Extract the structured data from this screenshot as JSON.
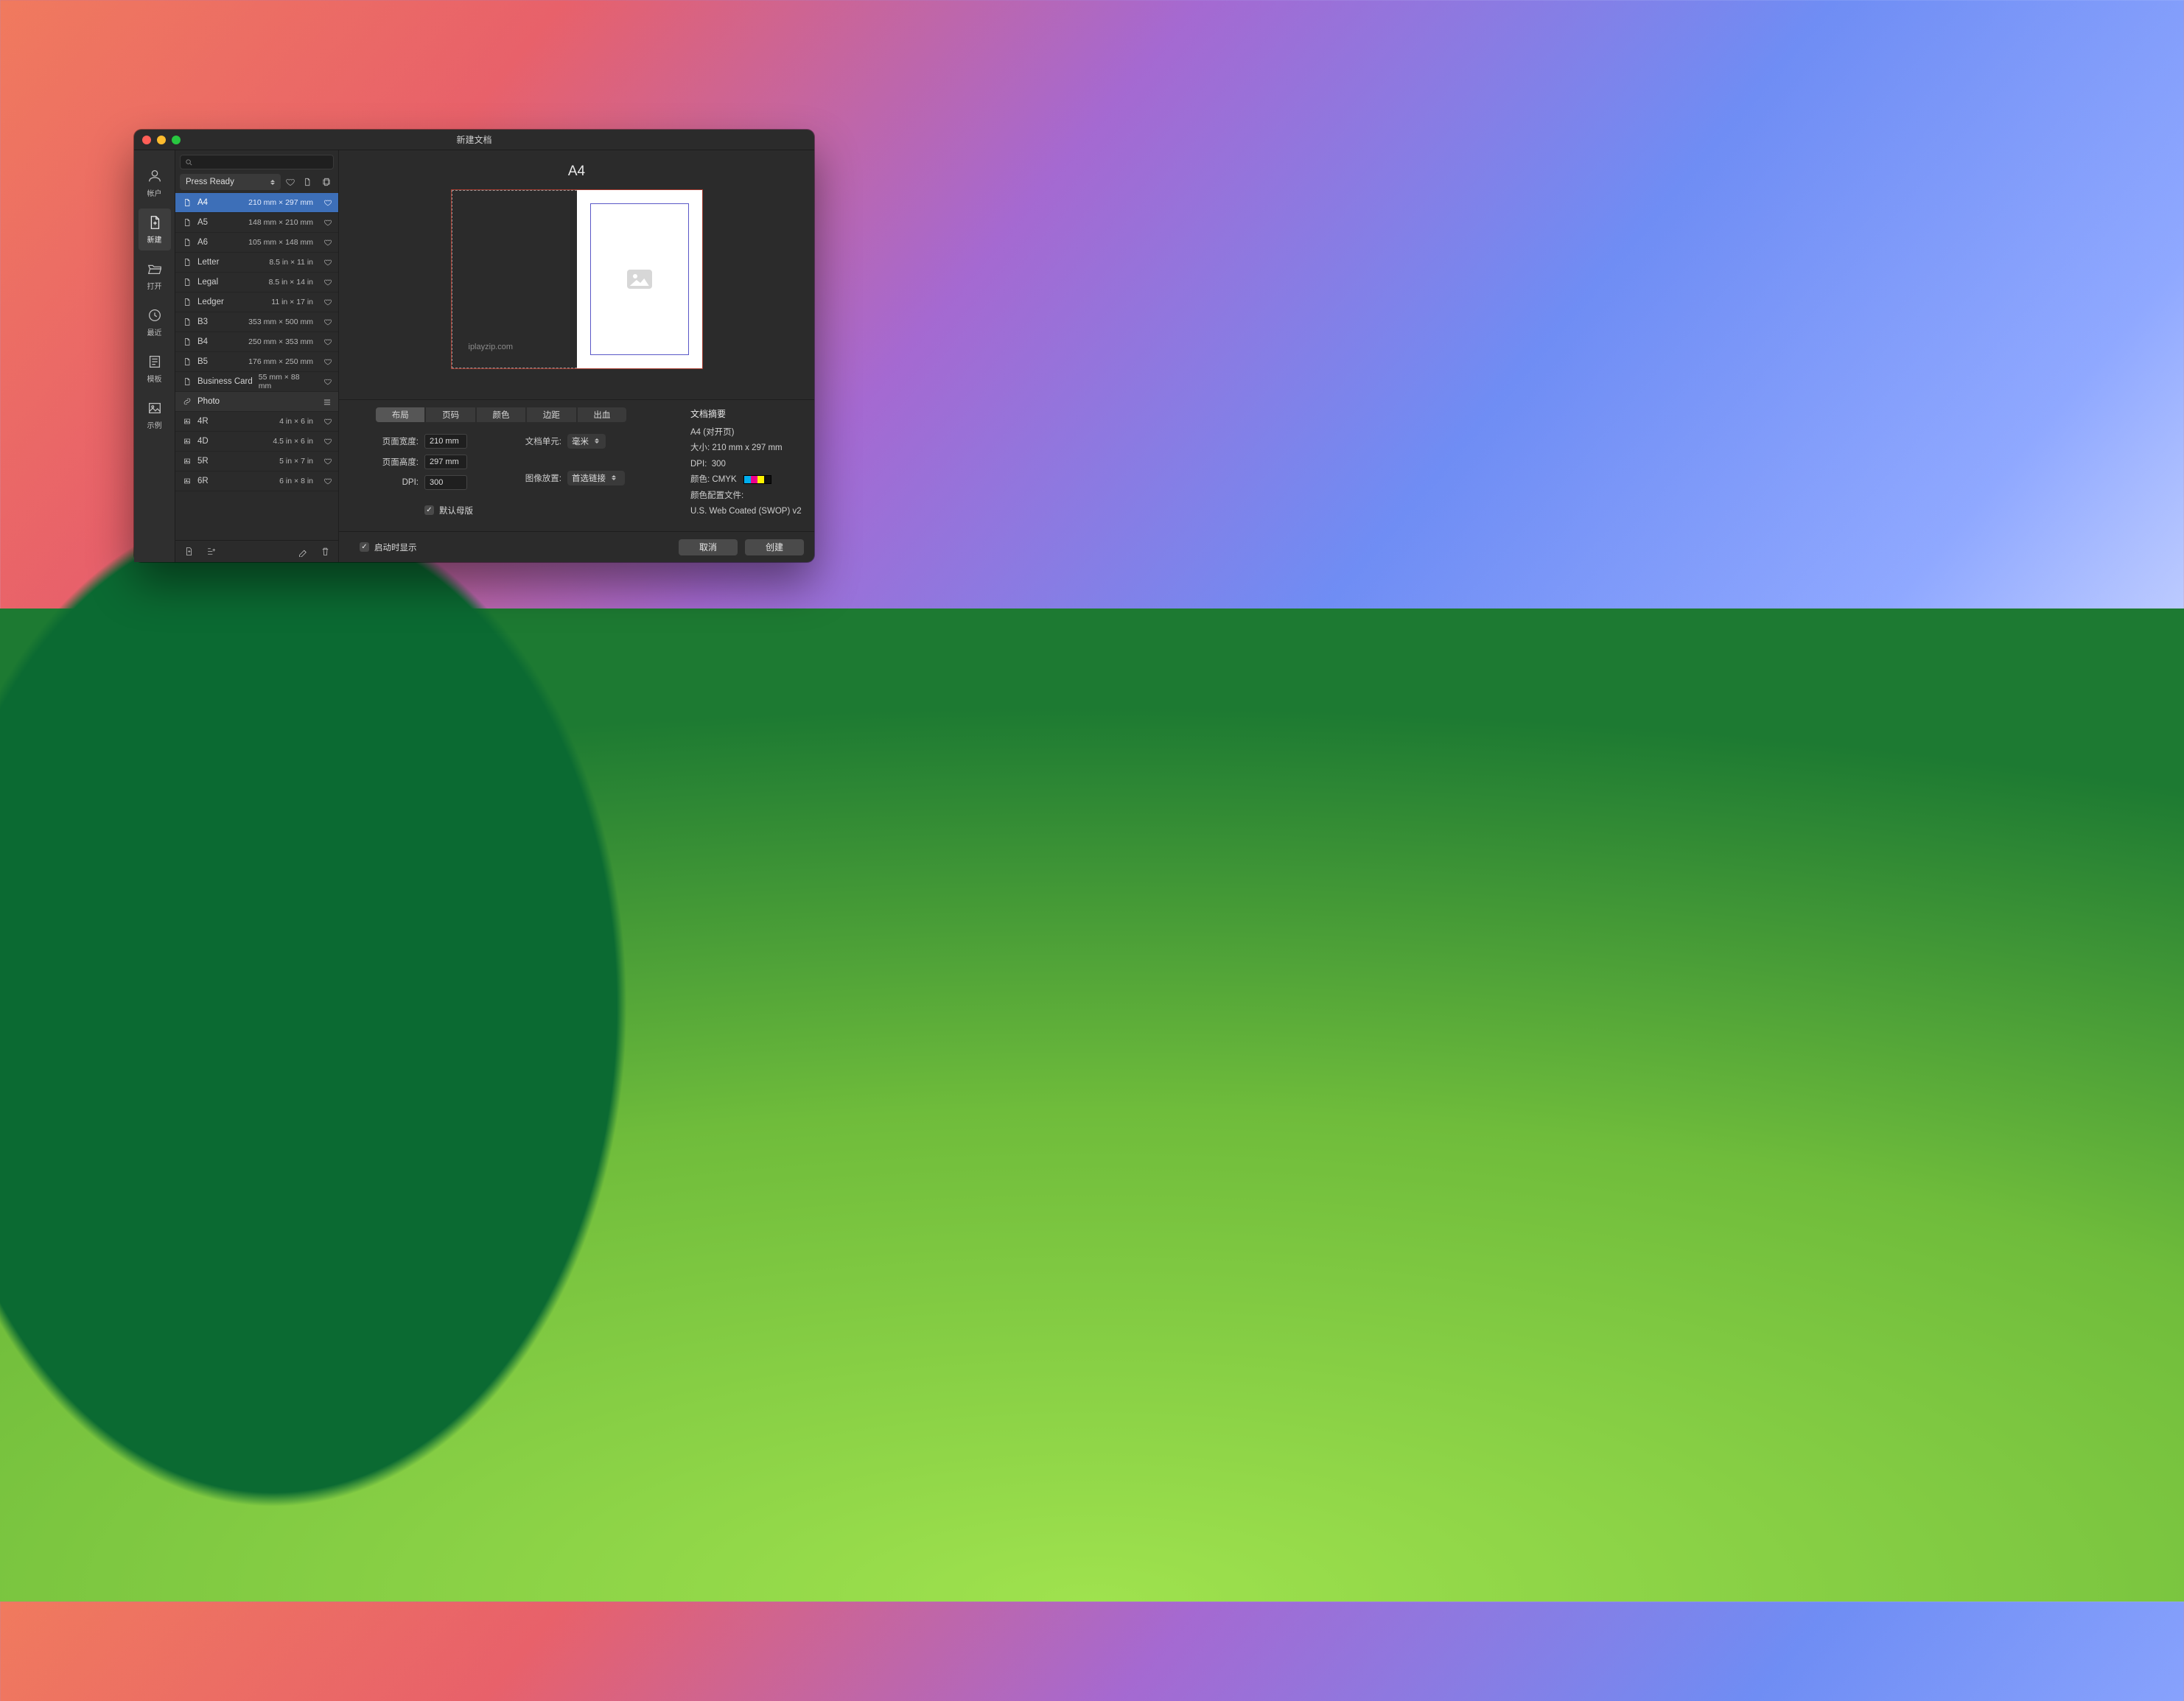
{
  "window": {
    "title": "新建文档"
  },
  "rail": [
    {
      "id": "account",
      "label": "帐户"
    },
    {
      "id": "new",
      "label": "新建"
    },
    {
      "id": "open",
      "label": "打开"
    },
    {
      "id": "recent",
      "label": "最近"
    },
    {
      "id": "templates",
      "label": "模板"
    },
    {
      "id": "samples",
      "label": "示例"
    }
  ],
  "category": "Press Ready",
  "presets": [
    {
      "name": "A4",
      "dims": "210 mm × 297 mm",
      "icon": "page",
      "selected": true
    },
    {
      "name": "A5",
      "dims": "148 mm × 210 mm",
      "icon": "page"
    },
    {
      "name": "A6",
      "dims": "105 mm × 148 mm",
      "icon": "page"
    },
    {
      "name": "Letter",
      "dims": "8.5 in × 11 in",
      "icon": "page"
    },
    {
      "name": "Legal",
      "dims": "8.5 in × 14 in",
      "icon": "page"
    },
    {
      "name": "Ledger",
      "dims": "11 in × 17 in",
      "icon": "page"
    },
    {
      "name": "B3",
      "dims": "353 mm × 500 mm",
      "icon": "page"
    },
    {
      "name": "B4",
      "dims": "250 mm × 353 mm",
      "icon": "page"
    },
    {
      "name": "B5",
      "dims": "176 mm × 250 mm",
      "icon": "page"
    },
    {
      "name": "Business Card",
      "dims": "55 mm × 88 mm",
      "icon": "page"
    }
  ],
  "group": {
    "name": "Photo"
  },
  "photo_presets": [
    {
      "name": "4R",
      "dims": "4 in × 6 in"
    },
    {
      "name": "4D",
      "dims": "4.5 in × 6 in"
    },
    {
      "name": "5R",
      "dims": "5 in × 7 in"
    },
    {
      "name": "6R",
      "dims": "6 in × 8 in"
    }
  ],
  "preview": {
    "title": "A4",
    "watermark": "iplayzip.com"
  },
  "tabs": [
    "布局",
    "页码",
    "颜色",
    "边距",
    "出血"
  ],
  "form": {
    "page_width_label": "页面宽度:",
    "page_width": "210 mm",
    "page_height_label": "页面高度:",
    "page_height": "297 mm",
    "dpi_label": "DPI:",
    "dpi": "300",
    "doc_unit_label": "文档单元:",
    "doc_unit": "毫米",
    "image_place_label": "图像放置:",
    "image_place": "首选链接",
    "default_master_label": "默认母版"
  },
  "summary": {
    "title": "文档摘要",
    "line1": "A4 (对开页)",
    "size_label": "大小:",
    "size": "210 mm x 297 mm",
    "dpi_label": "DPI:",
    "dpi": "300",
    "color_label": "颜色:",
    "color": "CMYK",
    "swatches": [
      "#00aeef",
      "#ec008c",
      "#fff200",
      "#111111"
    ],
    "profile_label": "颜色配置文件:",
    "profile": "U.S. Web Coated (SWOP) v2"
  },
  "footer": {
    "show_on_start": "启动时显示",
    "cancel": "取消",
    "create": "创建"
  }
}
